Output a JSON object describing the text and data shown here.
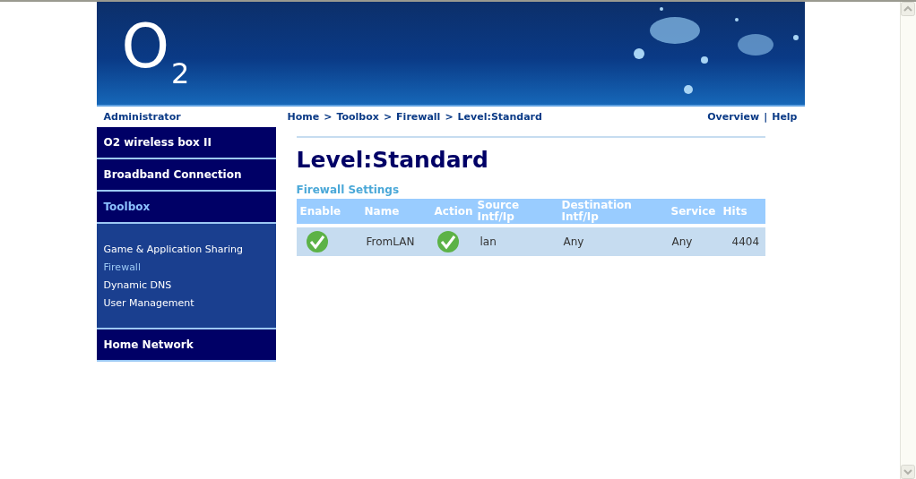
{
  "logo": {
    "main": "O",
    "sub": "2"
  },
  "nav": {
    "user": "Administrator",
    "breadcrumb": [
      "Home",
      "Toolbox",
      "Firewall",
      "Level:Standard"
    ],
    "separator": ">",
    "links": [
      "Overview",
      "Help"
    ],
    "link_separator": "|"
  },
  "sidebar": {
    "items": [
      {
        "label": "O2 wireless box II",
        "selected": false
      },
      {
        "label": "Broadband Connection",
        "selected": false
      },
      {
        "label": "Toolbox",
        "selected": true,
        "children": [
          {
            "label": "Game & Application Sharing",
            "selected": false
          },
          {
            "label": "Firewall",
            "selected": true
          },
          {
            "label": "Dynamic DNS",
            "selected": false
          },
          {
            "label": "User Management",
            "selected": false
          }
        ]
      },
      {
        "label": "Home Network",
        "selected": false
      }
    ]
  },
  "page": {
    "title": "Level:Standard",
    "section": "Firewall Settings"
  },
  "table": {
    "columns": [
      [
        "Enable"
      ],
      [
        "Name"
      ],
      [
        "Action"
      ],
      [
        "Source",
        "Intf/Ip"
      ],
      [
        "Destination",
        "Intf/Ip"
      ],
      [
        "Service"
      ],
      [
        "Hits"
      ]
    ],
    "rows": [
      {
        "enabled": true,
        "name": "FromLAN",
        "allowed": true,
        "source": "lan",
        "destination": "Any",
        "service": "Any",
        "hits": "4404"
      }
    ]
  }
}
